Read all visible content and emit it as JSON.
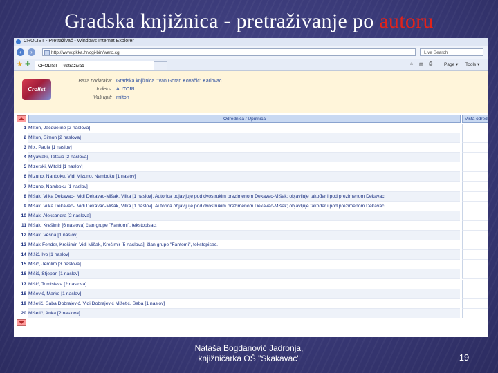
{
  "slide": {
    "title_part1": "Gradska knjižnica - pretraživanje po ",
    "title_highlight": "autoru",
    "footer_line1": "Nataša Bogdanović Jadronja,",
    "footer_line2": "knjižničarka OŠ \"Skakavac\"",
    "page_number": "19",
    "highlight_color": "#e2231a"
  },
  "browser": {
    "window_title": "CROLIST - Pretraživač - Windows Internet Explorer",
    "address": "http://www.gkka.hr/cgi-bin/wero.cgi",
    "live_search_placeholder": "Live Search",
    "tab_label": "CROLIST - Pretraživač",
    "tools": [
      "Page ▾",
      "Tools ▾"
    ]
  },
  "crolist": {
    "logo_text": "Crolist",
    "info": [
      {
        "label": "Baza podataka:",
        "value": "Gradska knjižnica \"Ivan Goran Kovačić\" Karlovac"
      },
      {
        "label": "Indeks:",
        "value": "AUTORI"
      },
      {
        "label": "Vaš upit:",
        "value": "milton"
      }
    ],
    "col_main_header": "Odrednica / Uputnica",
    "col_side_header": "Vista odred",
    "rows": [
      {
        "num": "1",
        "text": "Milton, Jacqueline [2 naslova]"
      },
      {
        "num": "2",
        "text": "Milton, Simon [2 naslova]"
      },
      {
        "num": "3",
        "text": "Mix, Paola [1 naslov]"
      },
      {
        "num": "4",
        "text": "Miyawaki, Tatsuo [2 naslova]"
      },
      {
        "num": "5",
        "text": "Mizerski, Witold [1 naslov]"
      },
      {
        "num": "6",
        "text": "Mizuno, Nanboku. Vidi Mizuno, Namboku [1 naslov]"
      },
      {
        "num": "7",
        "text": "Mizuno, Namboku [1 naslov]"
      },
      {
        "num": "8",
        "text": "Mišak, Vilka Dekavac-. Vidi Dekavac-Mišak, Vilka [1 naslov]. Autorica pojavljuje pod dvostrukim prezimenom Dekavac-Mišak; objavljuje također i pod prezimenom Dekavac."
      },
      {
        "num": "9",
        "text": "Mišak, Vilka Dekavac-. Vidi Dekavac-Mišak, Vilka [1 naslov]. Autorica objavljuje pod dvostrukim prezimenom Dekavac-Mišak; objavljuje također i pod prezimenom Dekavac."
      },
      {
        "num": "10",
        "text": "Mišak, Aleksandra [2 naslova]"
      },
      {
        "num": "11",
        "text": "Mišak, Krešimir [6 naslova] član grupe \"Fantomi\", tekstopisac."
      },
      {
        "num": "12",
        "text": "Mišak, Vesna [1 naslov]"
      },
      {
        "num": "13",
        "text": "Mišak-Fender, Krešimir. Vidi Mišak, Krešimir [5 naslova]; član grupe \"Fantomi\", tekstopisac."
      },
      {
        "num": "14",
        "text": "Mišić, Ivo [1 naslov]"
      },
      {
        "num": "15",
        "text": "Mišić, Jerolim [3 naslova]"
      },
      {
        "num": "16",
        "text": "Mišić, Stjepan [1 naslov]"
      },
      {
        "num": "17",
        "text": "Mišić, Tomislava [2 naslova]"
      },
      {
        "num": "18",
        "text": "Mišević, Marko [1 naslov]"
      },
      {
        "num": "19",
        "text": "Mišetić, Saba Dobrajević. Vidi Dobrajević Mišetić, Saba [1 naslov]"
      },
      {
        "num": "20",
        "text": "Mišetić, Anka [2 naslova]"
      }
    ]
  }
}
